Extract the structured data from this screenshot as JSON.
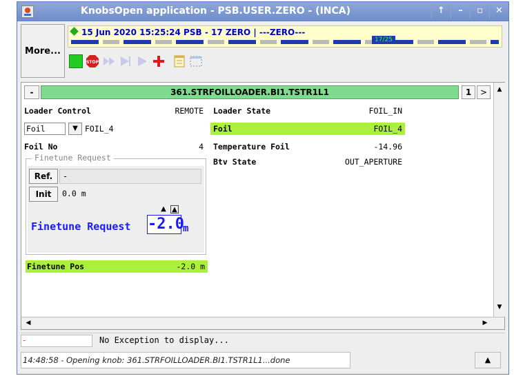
{
  "window": {
    "title": "KnobsOpen application - PSB.USER.ZERO - (INCA)",
    "controls": [
      "pin-icon",
      "minimize-icon",
      "maximize-icon",
      "close-icon"
    ]
  },
  "toolbar": {
    "more_label": "More...",
    "status_text": "15 Jun 2020  15:25:24  PSB - 17 ZERO | ---ZERO---",
    "cycle_counter": "17/25",
    "icons": [
      "start-icon",
      "stop-icon",
      "play-fast-icon",
      "step-icon",
      "play-icon",
      "add-icon",
      "notes-icon",
      "layout-icon"
    ]
  },
  "panel": {
    "collapse_label": "-",
    "device_name": "361.STRFOILLOADER.BI1.TSTR1L1",
    "page": "1",
    "next_label": ">",
    "left": {
      "loader_control_label": "Loader Control",
      "loader_control_value": "REMOTE",
      "foil_selected": "Foil",
      "foil_readout": "FOIL_4",
      "foil_no_label": "Foil No",
      "foil_no_value": "4",
      "finetune_group_title": "Finetune Request",
      "ref_label": "Ref.",
      "ref_value": "-",
      "init_label": "Init",
      "init_value": "0.0 m",
      "finetune_label": "Finetune Request",
      "finetune_value": "-2.0",
      "finetune_unit": "m",
      "finetune_pos_label": "Finetune Pos",
      "finetune_pos_value": "-2.0 m"
    },
    "right": {
      "loader_state_label": "Loader State",
      "loader_state_value": "FOIL_IN",
      "foil_label": "Foil",
      "foil_value": "FOIL_4",
      "temp_label": "Temperature Foil",
      "temp_value": "-14.96",
      "btv_label": "Btv State",
      "btv_value": "OUT_APERTURE"
    }
  },
  "footer": {
    "exception_marker": "-",
    "exception_text": "No Exception to display...",
    "log_text": "14:48:58 - Opening knob: 361.STRFOILLOADER.BI1.TSTR1L1...done"
  },
  "colors": {
    "header_green": "#7fdc8f",
    "highlight_green": "#aaf03c",
    "finetune_blue": "#1a1aff",
    "title_blue": "#6d8cc8",
    "status_yellow": "#ffffcc"
  }
}
